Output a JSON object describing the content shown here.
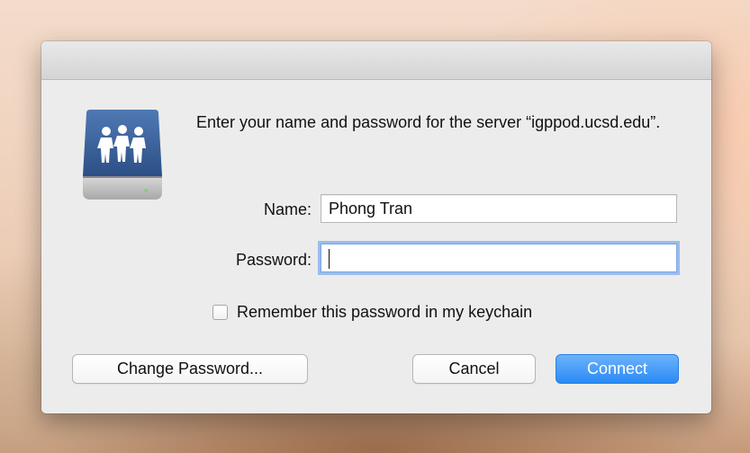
{
  "dialog": {
    "message": "Enter your name and password for the server “igppod.ucsd.edu”.",
    "icon": "shared-server-icon",
    "name_label": "Name:",
    "name_value": "Phong Tran",
    "password_label": "Password:",
    "password_value": "",
    "remember_label": "Remember this password in my keychain",
    "remember_checked": false
  },
  "buttons": {
    "change_password": "Change Password...",
    "cancel": "Cancel",
    "connect": "Connect"
  },
  "colors": {
    "accent": "#2a8af6",
    "focus_ring": "#5a96f0",
    "dialog_bg": "#ececec"
  }
}
